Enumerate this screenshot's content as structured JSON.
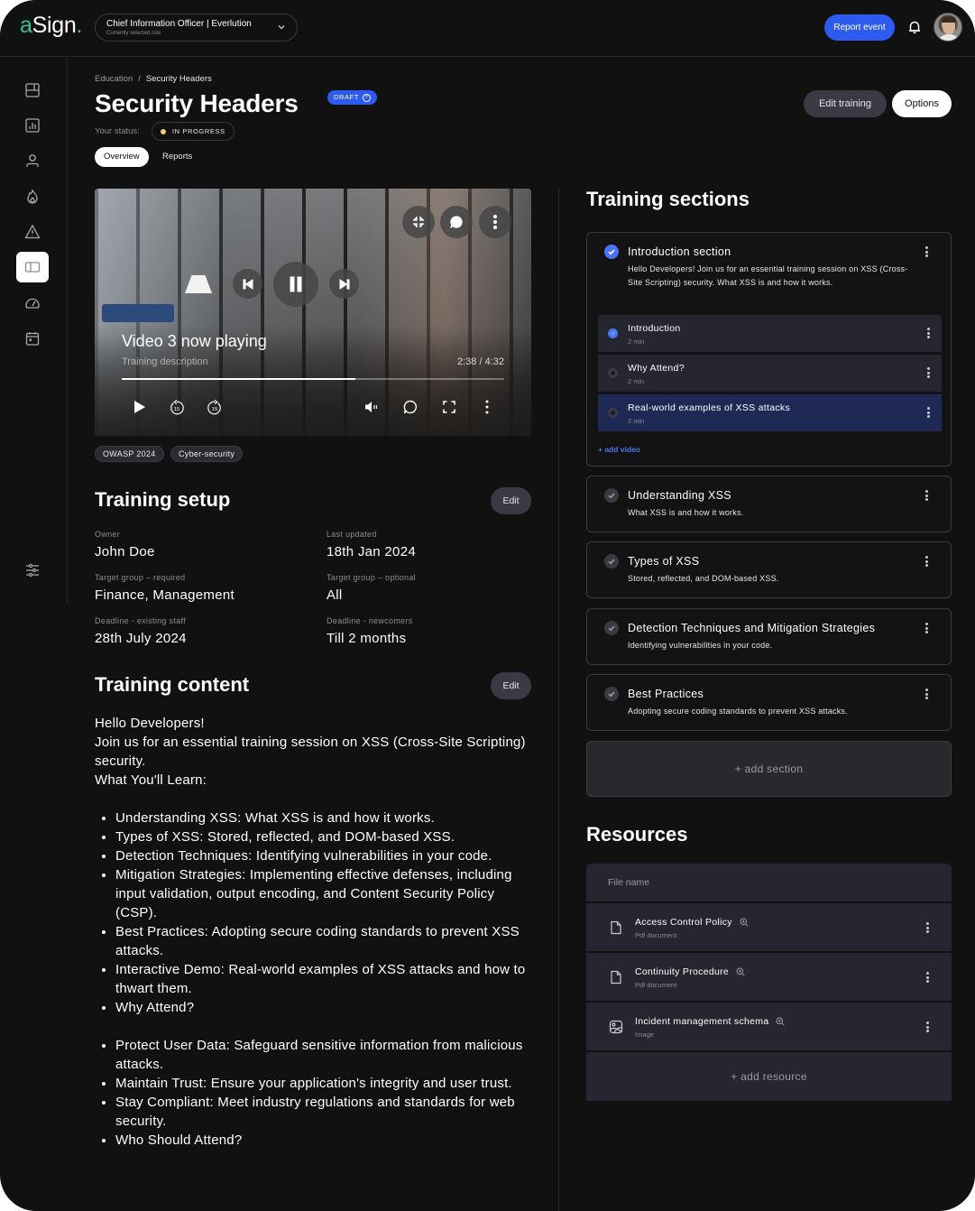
{
  "app": {
    "logo_prefix": "a",
    "logo_main": "Sign",
    "logo_dot": "."
  },
  "topbar": {
    "role_title": "Chief Information Officer | Everlution",
    "role_subtitle": "Currently selected role",
    "report_button": "Report event",
    "icons": [
      "chevron-down-icon",
      "bell-icon",
      "avatar"
    ]
  },
  "sidebar": {
    "items": [
      {
        "icon": "layout-icon",
        "active": false
      },
      {
        "icon": "bar-chart-icon",
        "active": false
      },
      {
        "icon": "user-icon",
        "active": false
      },
      {
        "icon": "flame-icon",
        "active": false
      },
      {
        "icon": "warning-icon",
        "active": false
      },
      {
        "icon": "book-icon",
        "active": true
      },
      {
        "icon": "speedometer-icon",
        "active": false
      },
      {
        "icon": "calendar-icon",
        "active": false
      }
    ],
    "bottom_icon": "sliders-icon"
  },
  "header": {
    "breadcrumb": [
      "Education",
      "Security Headers"
    ],
    "breadcrumb_sep": "/",
    "title": "Security Headers",
    "draft_badge": "DRAFT",
    "draft_help": "?",
    "status_label": "Your status:",
    "status_value": "IN PROGRESS",
    "tabs": [
      {
        "label": "Overview",
        "active": true
      },
      {
        "label": "Reports",
        "active": false
      }
    ],
    "edit_training_button": "Edit training",
    "options_button": "Options"
  },
  "video": {
    "title": "Video 3 now playing",
    "description": "Training description",
    "time": "2:38 / 4:32",
    "progress_fraction": 0.61,
    "rewind_label": "15",
    "forward_label": "15"
  },
  "tags": [
    "OWASP 2024",
    "Cyber-security"
  ],
  "setup": {
    "title": "Training setup",
    "edit_button": "Edit",
    "fields": [
      {
        "label": "Owner",
        "value": "John Doe"
      },
      {
        "label": "Last updated",
        "value": "18th Jan 2024"
      },
      {
        "label": "Target group – required",
        "value": "Finance, Management"
      },
      {
        "label": "Target group – optional",
        "value": "All"
      },
      {
        "label": "Deadline - existing staff",
        "value": "28th July 2024"
      },
      {
        "label": "Deadline - newcomers",
        "value": "Till 2 months"
      }
    ]
  },
  "content": {
    "title": "Training content",
    "edit_button": "Edit",
    "intro": [
      "Hello Developers!",
      "Join us for an essential training session on XSS (Cross-Site Scripting) security.",
      "What You'll Learn:"
    ],
    "learn_items": [
      "Understanding XSS: What XSS is and how it works.",
      "Types of XSS: Stored, reflected, and DOM-based XSS.",
      "Detection Techniques: Identifying vulnerabilities in your code.",
      "Mitigation Strategies: Implementing effective defenses, including input validation, output encoding, and Content Security Policy (CSP).",
      "Best Practices: Adopting secure coding standards to prevent XSS attacks.",
      "Interactive Demo: Real-world examples of XSS attacks and how to thwart them.",
      "Why Attend?"
    ],
    "attend_items": [
      "Protect User Data: Safeguard sensitive information from malicious attacks.",
      "Maintain Trust: Ensure your application's integrity and user trust.",
      "Stay Compliant: Meet industry regulations and standards for web security.",
      "Who Should Attend?"
    ]
  },
  "training_sections": {
    "title": "Training sections",
    "sections": [
      {
        "title": "Introduction section",
        "description": "Hello Developers! Join us for an essential training session on XSS (Cross-Site Scripting) security. What XSS is and how it works.",
        "status": "active",
        "videos": [
          {
            "title": "Introduction",
            "duration": "2 min",
            "state": "playing"
          },
          {
            "title": "Why Attend?",
            "duration": "2 min",
            "state": "idle"
          },
          {
            "title": "Real-world examples of XSS attacks",
            "duration": "2 min",
            "state": "selected"
          }
        ],
        "add_video": "+ add video"
      },
      {
        "title": "Understanding XSS",
        "description": "What XSS is and how it works.",
        "status": "done"
      },
      {
        "title": "Types of XSS",
        "description": "Stored, reflected, and DOM-based XSS.",
        "status": "done"
      },
      {
        "title": "Detection Techniques and Mitigation Strategies",
        "description": " Identifying vulnerabilities in your code.",
        "status": "done"
      },
      {
        "title": "Best Practices",
        "description": "Adopting secure coding standards to prevent XSS attacks.",
        "status": "done"
      }
    ],
    "add_section": "+ add section"
  },
  "resources": {
    "title": "Resources",
    "column_header": "File name",
    "files": [
      {
        "name": "Access Control Policy",
        "type": "Pdf document",
        "icon": "file-icon"
      },
      {
        "name": "Continuity Procedure",
        "type": "Pdf document",
        "icon": "file-icon"
      },
      {
        "name": "Incident management schema",
        "type": "Image",
        "icon": "image-icon"
      }
    ],
    "add_resource": "+ add resource"
  },
  "colors": {
    "background": "#111111",
    "accent": "#2d5bf0",
    "accent_light": "#4a74f5",
    "brand_green": "#34c38f",
    "status_dot": "#f3c96a",
    "panel": "#262630",
    "selected_row": "#1e2a55"
  }
}
